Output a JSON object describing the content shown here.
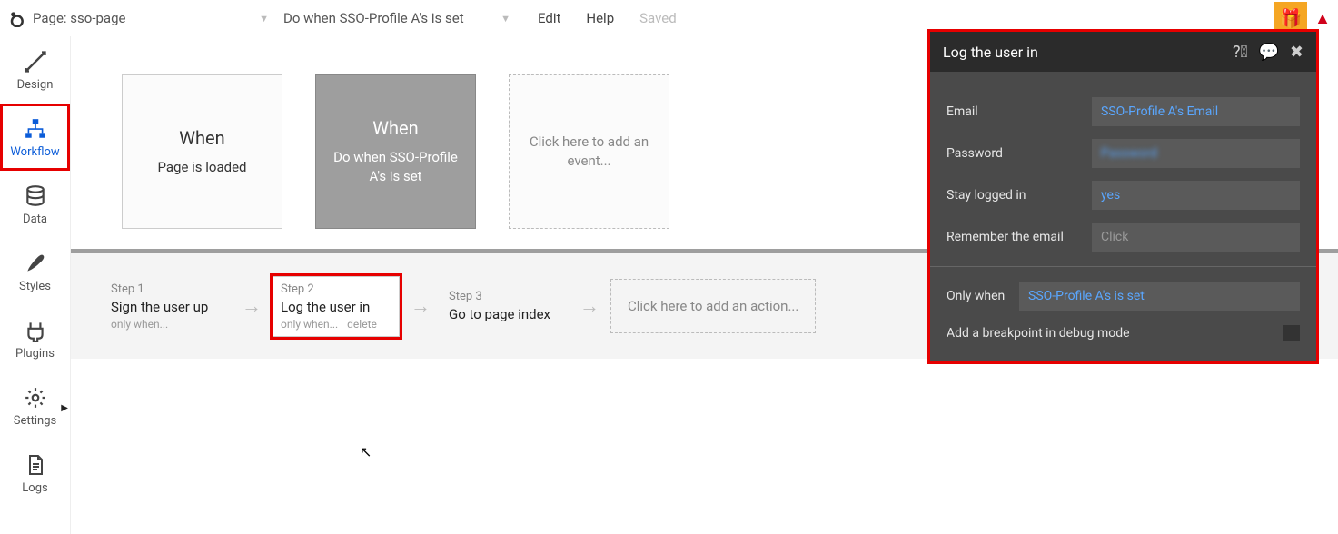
{
  "topbar": {
    "page_prefix": "Page:",
    "page_name": "sso-page",
    "condition": "Do when SSO-Profile A's is set",
    "menu": {
      "edit": "Edit",
      "help": "Help",
      "saved": "Saved"
    }
  },
  "sidebar": {
    "design": "Design",
    "workflow": "Workflow",
    "data": "Data",
    "styles": "Styles",
    "plugins": "Plugins",
    "settings": "Settings",
    "logs": "Logs"
  },
  "events": [
    {
      "when": "When",
      "desc": "Page is loaded"
    },
    {
      "when": "When",
      "desc": "Do when SSO-Profile A's is set"
    }
  ],
  "add_event": "Click here to add an event...",
  "steps": [
    {
      "label": "Step 1",
      "title": "Sign the user up",
      "sub": "only when..."
    },
    {
      "label": "Step 2",
      "title": "Log the user in",
      "sub": "only when...",
      "delete": "delete"
    },
    {
      "label": "Step 3",
      "title": "Go to page index"
    }
  ],
  "add_action": "Click here to add an action...",
  "panel": {
    "title": "Log the user in",
    "fields": {
      "email_label": "Email",
      "email_value": "SSO-Profile A's Email",
      "password_label": "Password",
      "password_value": "Password",
      "stay_label": "Stay logged in",
      "stay_value": "yes",
      "remember_label": "Remember the email",
      "remember_placeholder": "Click",
      "onlywhen_label": "Only when",
      "onlywhen_value": "SSO-Profile A's is set",
      "breakpoint_label": "Add a breakpoint in debug mode"
    }
  }
}
